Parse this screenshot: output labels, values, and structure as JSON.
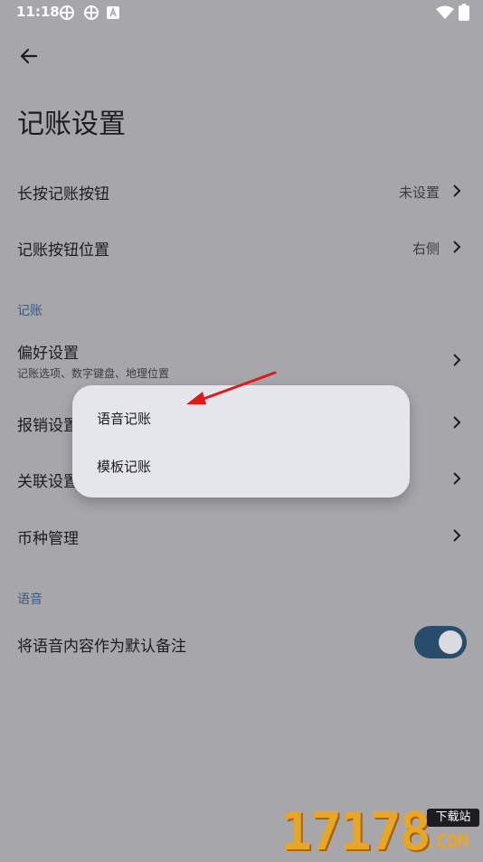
{
  "status_bar": {
    "time": "11:18"
  },
  "header": {
    "title": "记账设置"
  },
  "rows": {
    "long_press": {
      "label": "长按记账按钮",
      "value": "未设置"
    },
    "button_position": {
      "label": "记账按钮位置",
      "value": "右侧"
    }
  },
  "section_bookkeeping": {
    "title": "记账",
    "preferences": {
      "label": "偏好设置",
      "subtitle": "记账选项、数字键盘、地理位置"
    },
    "reimbursement": {
      "label": "报销设置"
    },
    "link": {
      "label": "关联设置"
    },
    "currency": {
      "label": "币种管理"
    }
  },
  "section_voice": {
    "title": "语音",
    "voice_note": {
      "label": "将语音内容作为默认备注",
      "toggle_on": true
    }
  },
  "popup_menu": {
    "items": [
      "语音记账",
      "模板记账"
    ]
  },
  "watermark": {
    "digits": "17178",
    "badge": "下载站",
    "domain": ".COM"
  },
  "colors": {
    "background": "#a7a6ab",
    "popup": "#e5e6ec",
    "toggle_on": "#284d6c",
    "section_title": "#3f5a7d",
    "annotation_arrow": "#e0191b"
  }
}
